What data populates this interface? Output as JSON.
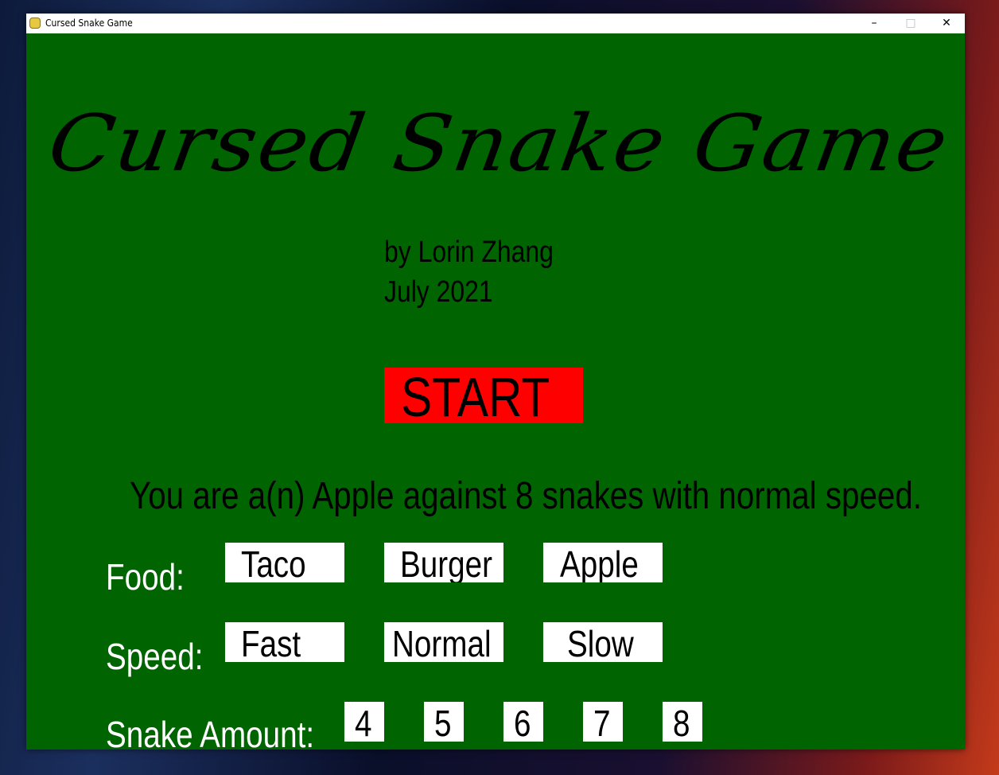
{
  "window": {
    "title": "Cursed Snake Game",
    "controls": {
      "minimize": "–",
      "maximize": "□",
      "close": "✕"
    },
    "app_icon": "pygame-snake-icon"
  },
  "game": {
    "title": "Cursed Snake Game",
    "author": "by Lorin Zhang",
    "date": "July 2021",
    "start_label": "START",
    "status": "You are a(n) Apple against 8 snakes with normal speed.",
    "food": {
      "label": "Food:",
      "options": [
        "Taco",
        "Burger",
        "Apple"
      ]
    },
    "speed": {
      "label": "Speed:",
      "options": [
        "Fast",
        "Normal",
        "Slow"
      ]
    },
    "snakes": {
      "label": "Snake Amount:",
      "options": [
        "4",
        "5",
        "6",
        "7",
        "8"
      ]
    },
    "colors": {
      "background": "#006400",
      "start": "#ff0000",
      "button": "#ffffff",
      "label": "#ffffff"
    }
  }
}
